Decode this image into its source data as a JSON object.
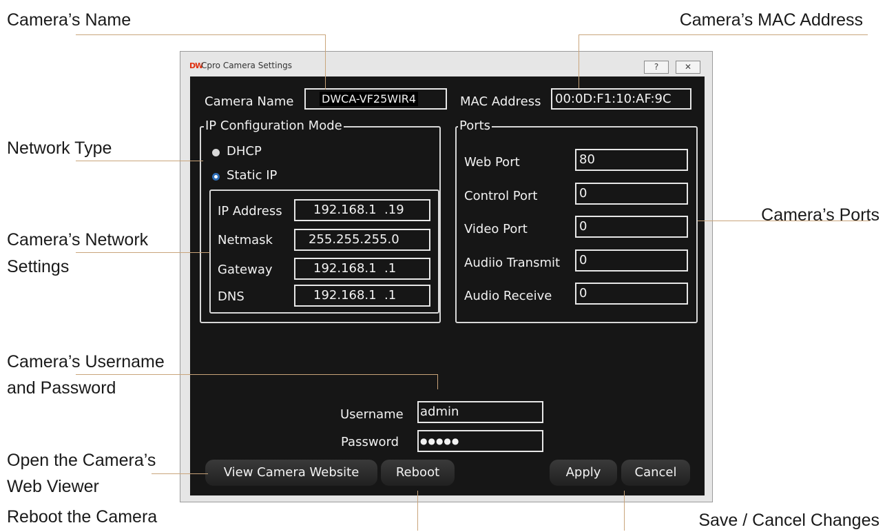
{
  "callouts": {
    "camera_name": "Camera’s Name",
    "mac_address": "Camera’s MAC Address",
    "network_type": "Network Type",
    "network_settings_line1": "Camera’s Network",
    "network_settings_line2": "Settings",
    "ports": "Camera’s Ports",
    "credentials_line1": "Camera’s Username",
    "credentials_line2": "and Password",
    "web_viewer_line1": "Open the Camera’s",
    "web_viewer_line2": "Web Viewer",
    "reboot": "Reboot the Camera",
    "save_cancel": "Save / Cancel Changes"
  },
  "window": {
    "logo": "DW",
    "title": "Cpro Camera Settings",
    "help_icon": "?",
    "close_icon": "✕"
  },
  "camera": {
    "name_label": "Camera Name",
    "name_value": "DWCA-VF25WIR4",
    "mac_label": "MAC Address",
    "mac_value": "00:0D:F1:10:AF:9C"
  },
  "ip_config": {
    "legend": "IP Configuration Mode",
    "dhcp_label": "DHCP",
    "static_label": "Static IP",
    "selected": "Static IP",
    "fields": [
      {
        "label": "IP Address",
        "value": "192.168.1  .19"
      },
      {
        "label": "Netmask",
        "value": "255.255.255.0"
      },
      {
        "label": "Gateway",
        "value": "192.168.1  .1"
      },
      {
        "label": "DNS",
        "value": "192.168.1  .1"
      }
    ]
  },
  "ports": {
    "legend": "Ports",
    "fields": [
      {
        "label": "Web Port",
        "value": "80"
      },
      {
        "label": "Control Port",
        "value": "0"
      },
      {
        "label": "Video Port",
        "value": "0"
      },
      {
        "label": "Audiio Transmit",
        "value": "0"
      },
      {
        "label": "Audio Receive",
        "value": "0"
      }
    ]
  },
  "credentials": {
    "username_label": "Username",
    "username_value": "admin",
    "password_label": "Password",
    "password_value": "●●●●●"
  },
  "buttons": {
    "view_website": "View Camera Website",
    "reboot": "Reboot",
    "apply": "Apply",
    "cancel": "Cancel"
  },
  "colors": {
    "panel_bg": "#161616",
    "accent_leader": "#c9a47a"
  }
}
